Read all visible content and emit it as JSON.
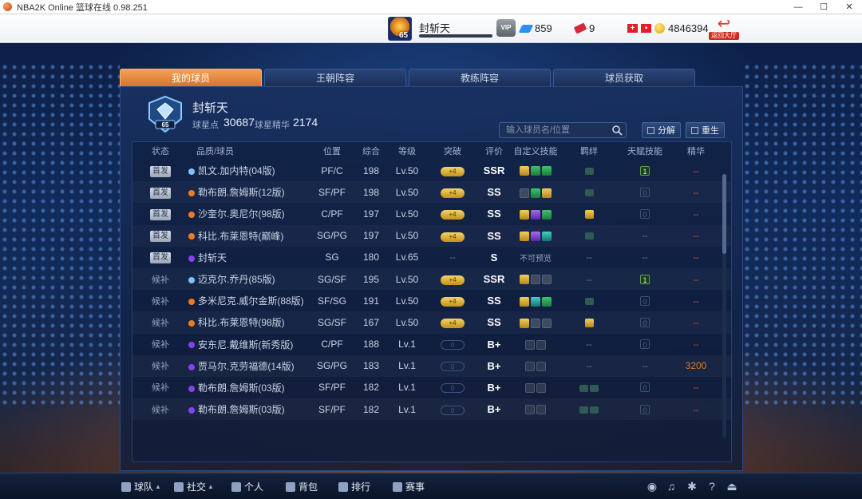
{
  "window": {
    "title": "NBA2K Online 篮球在线 0.98.251",
    "controls": [
      "—",
      "☐",
      "✕"
    ]
  },
  "topbar": {
    "avatar_level": "65",
    "player_name": "封斩天",
    "xp_progress": 0,
    "vip_label": "VIP",
    "diamonds": "859",
    "tickets": "9",
    "coins": "4846394",
    "back_label": "返回大厅"
  },
  "tabs": [
    {
      "label": "我的球员",
      "active": true
    },
    {
      "label": "王朝阵容",
      "active": false
    },
    {
      "label": "教练阵容",
      "active": false
    },
    {
      "label": "球员获取",
      "active": false
    }
  ],
  "profile": {
    "emblem_level": "65",
    "name": "封斩天",
    "star_points_label": "球星点",
    "star_points": "30687",
    "essence_label": "球星精华",
    "essence": "2174"
  },
  "search": {
    "placeholder": "输入球员名/位置"
  },
  "actions": {
    "decompose": "分解",
    "rebirth": "重生"
  },
  "table": {
    "headers": [
      "状态",
      "品质/球员",
      "位置",
      "综合",
      "等级",
      "突破",
      "评价",
      "自定义技能",
      "羁绊",
      "天赋技能",
      "精华"
    ],
    "rows": [
      {
        "status": "首发",
        "starter": true,
        "quality_color": "#7fc4ff",
        "name": "凯文.加内特(04版)",
        "pos": "PF/C",
        "ovr": "198",
        "lv": "Lv.50",
        "breakthrough": "+4",
        "grade": "SSR",
        "skills": [
          "gold",
          "green",
          "green"
        ],
        "skill_note": "",
        "bonds": [
          "teal"
        ],
        "talent": "1",
        "talent_on": true,
        "essence": "--"
      },
      {
        "status": "首发",
        "starter": true,
        "quality_color": "#f07a22",
        "name": "勒布朗.詹姆斯(12版)",
        "pos": "SF/PF",
        "ovr": "198",
        "lv": "Lv.50",
        "breakthrough": "+4",
        "grade": "SS",
        "skills": [
          "gray",
          "green",
          "gold"
        ],
        "skill_note": "",
        "bonds": [
          "teal"
        ],
        "talent": "0",
        "talent_on": false,
        "essence": "--"
      },
      {
        "status": "首发",
        "starter": true,
        "quality_color": "#f07a22",
        "name": "沙奎尔.奥尼尔(98版)",
        "pos": "C/PF",
        "ovr": "197",
        "lv": "Lv.50",
        "breakthrough": "+4",
        "grade": "SS",
        "skills": [
          "gold",
          "purple",
          "green"
        ],
        "skill_note": "",
        "bonds": [
          "gold"
        ],
        "talent": "0",
        "talent_on": false,
        "essence": "--"
      },
      {
        "status": "首发",
        "starter": true,
        "quality_color": "#f07a22",
        "name": "科比.布莱恩特(巅峰)",
        "pos": "SG/PG",
        "ovr": "197",
        "lv": "Lv.50",
        "breakthrough": "+4",
        "grade": "SS",
        "skills": [
          "gold",
          "purple",
          "teal"
        ],
        "skill_note": "",
        "bonds": [
          "teal"
        ],
        "talent": "--",
        "talent_on": false,
        "essence": "--"
      },
      {
        "status": "首发",
        "starter": true,
        "quality_color": "#8a3ff0",
        "name": "封斩天",
        "pos": "SG",
        "ovr": "180",
        "lv": "Lv.65",
        "breakthrough": "--",
        "grade": "S",
        "skills": [],
        "skill_note": "不可预览",
        "bonds": [],
        "talent": "--",
        "talent_on": false,
        "essence": "--"
      },
      {
        "status": "候补",
        "starter": false,
        "quality_color": "#7fc4ff",
        "name": "迈克尔.乔丹(85版)",
        "pos": "SG/SF",
        "ovr": "195",
        "lv": "Lv.50",
        "breakthrough": "+4",
        "grade": "SSR",
        "skills": [
          "gold",
          "gray",
          "gray"
        ],
        "skill_note": "",
        "bonds": [],
        "talent": "1",
        "talent_on": true,
        "essence": "--"
      },
      {
        "status": "候补",
        "starter": false,
        "quality_color": "#f07a22",
        "name": "多米尼克.威尔金斯(88版)",
        "pos": "SF/SG",
        "ovr": "191",
        "lv": "Lv.50",
        "breakthrough": "+4",
        "grade": "SS",
        "skills": [
          "gold",
          "teal",
          "green"
        ],
        "skill_note": "",
        "bonds": [
          "teal"
        ],
        "talent": "0",
        "talent_on": false,
        "essence": "--"
      },
      {
        "status": "候补",
        "starter": false,
        "quality_color": "#f07a22",
        "name": "科比.布莱恩特(98版)",
        "pos": "SG/SF",
        "ovr": "167",
        "lv": "Lv.50",
        "breakthrough": "+4",
        "grade": "SS",
        "skills": [
          "gold",
          "gray",
          "gray"
        ],
        "skill_note": "",
        "bonds": [
          "gold"
        ],
        "talent": "0",
        "talent_on": false,
        "essence": "--"
      },
      {
        "status": "候补",
        "starter": false,
        "quality_color": "#8a3ff0",
        "name": "安东尼.戴维斯(新秀版)",
        "pos": "C/PF",
        "ovr": "188",
        "lv": "Lv.1",
        "breakthrough": "0",
        "grade": "B+",
        "skills": [
          "lock",
          "lock"
        ],
        "skill_note": "",
        "bonds": [],
        "talent": "0",
        "talent_on": false,
        "essence": "--"
      },
      {
        "status": "候补",
        "starter": false,
        "quality_color": "#8a3ff0",
        "name": "贾马尔.克劳福德(14版)",
        "pos": "SG/PG",
        "ovr": "183",
        "lv": "Lv.1",
        "breakthrough": "0",
        "grade": "B+",
        "skills": [
          "lock",
          "lock"
        ],
        "skill_note": "",
        "bonds": [],
        "talent": "--",
        "talent_on": false,
        "essence": "3200"
      },
      {
        "status": "候补",
        "starter": false,
        "quality_color": "#8a3ff0",
        "name": "勒布朗.詹姆斯(03版)",
        "pos": "SF/PF",
        "ovr": "182",
        "lv": "Lv.1",
        "breakthrough": "0",
        "grade": "B+",
        "skills": [
          "lock",
          "lock"
        ],
        "skill_note": "",
        "bonds": [
          "teal",
          "teal"
        ],
        "talent": "0",
        "talent_on": false,
        "essence": "--"
      },
      {
        "status": "候补",
        "starter": false,
        "quality_color": "#8a3ff0",
        "name": "勒布朗.詹姆斯(03版)",
        "pos": "SF/PF",
        "ovr": "182",
        "lv": "Lv.1",
        "breakthrough": "0",
        "grade": "B+",
        "skills": [
          "lock",
          "lock"
        ],
        "skill_note": "",
        "bonds": [
          "teal",
          "teal"
        ],
        "talent": "0",
        "talent_on": false,
        "essence": "--"
      }
    ]
  },
  "bottom_nav": [
    {
      "label": "球队",
      "caret": true,
      "icon": "team-icon"
    },
    {
      "label": "社交",
      "caret": true,
      "icon": "heart-icon"
    },
    {
      "label": "个人",
      "caret": false,
      "icon": "person-icon"
    },
    {
      "label": "背包",
      "caret": false,
      "icon": "backpack-icon"
    },
    {
      "label": "排行",
      "caret": false,
      "icon": "ranking-icon"
    },
    {
      "label": "赛事",
      "caret": false,
      "icon": "trophy-icon"
    }
  ],
  "tools": [
    "headset-icon",
    "music-icon",
    "gear-icon",
    "help-icon",
    "exit-icon"
  ]
}
